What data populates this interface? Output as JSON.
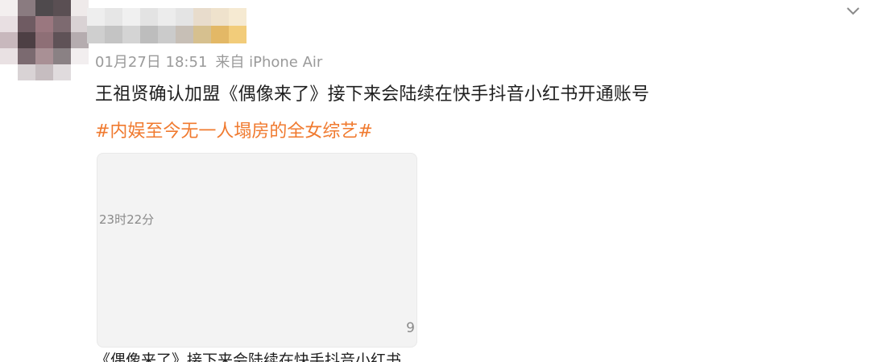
{
  "post": {
    "date": "01月27日 18:51",
    "source": "来自 iPhone Air",
    "text": "王祖贤确认加盟《偶像来了》接下来会陆续在快手抖音小红书开通账号",
    "hashtag": "#内娱至今无一人塌房的全女综艺#"
  },
  "card": {
    "time": "23时22分",
    "count": "9",
    "caption": "《偶像来了》接下来会陆续在快手抖音小红书"
  },
  "colors": {
    "hashtag": "#f07a2f",
    "meta": "#9a9a9a",
    "text": "#1f1f1f",
    "card_bg": "#f3f3f3"
  },
  "icons": {
    "collapse": "chevron-down-icon"
  }
}
